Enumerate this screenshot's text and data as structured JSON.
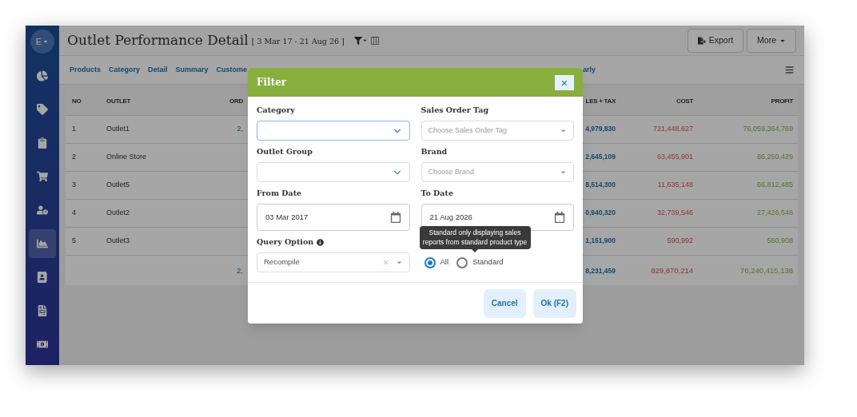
{
  "sidebar": {
    "avatar": "E",
    "items": [
      {
        "selected": false
      },
      {
        "selected": false
      },
      {
        "selected": false
      },
      {
        "selected": false
      },
      {
        "selected": false
      },
      {
        "selected": true
      },
      {
        "selected": false
      },
      {
        "selected": false
      },
      {
        "selected": false
      }
    ]
  },
  "header": {
    "title": "Outlet Performance Detail",
    "date_range": "[ 3 Mar 17 - 21 Aug 26 ]",
    "buttons": [
      {
        "label": "Export",
        "kind": "export"
      },
      {
        "label": "More",
        "kind": "more"
      }
    ]
  },
  "tabs": [
    {
      "label": "Products"
    },
    {
      "label": "Category"
    },
    {
      "label": "Detail"
    },
    {
      "label": "Summary"
    },
    {
      "label": "Custome"
    },
    {
      "label": "arly"
    }
  ],
  "table": {
    "columns": [
      "NO",
      "OUTLET",
      "ORD",
      "LES + TAX",
      "COST",
      "PROFIT"
    ],
    "rows": [
      [
        "1",
        "Outlet1",
        "2,",
        "4,979,830",
        "721,448,627",
        "76,059,364,769"
      ],
      [
        "2",
        "Online Store",
        null,
        "2,645,109",
        "63,455,901",
        "86,250,429"
      ],
      [
        "3",
        "Outlet5",
        null,
        "8,514,300",
        "11,635,148",
        "66,812,485"
      ],
      [
        "4",
        "Outlet2",
        null,
        "0,940,320",
        "32,739,546",
        "27,426,548"
      ],
      [
        "5",
        "Outlet3",
        null,
        "1,151,900",
        "590,992",
        "560,908"
      ]
    ],
    "total": {
      "column_3": "2,",
      "column_4": "8,231,459",
      "column_5": "829,870,214",
      "column_6": "76,240,415,138"
    }
  },
  "dialog": {
    "title": "Filter",
    "close": "×",
    "fields": [
      {
        "label": "Category",
        "kind": "select",
        "focused": true
      },
      {
        "label": "Sales Order Tag",
        "kind": "dropdown",
        "placeholder": "Choose Sales Order Tag"
      },
      {
        "label": "Outlet Group",
        "kind": "select",
        "focused": false
      },
      {
        "label": "Brand",
        "kind": "dropdown",
        "placeholder": "Choose Brand"
      },
      {
        "label": "From Date",
        "kind": "date",
        "value": "03 Mar 2017"
      },
      {
        "label": "To Date",
        "kind": "date",
        "value": "21 Aug 2026"
      },
      {
        "label": "Query Option",
        "kind": "clearable",
        "value": "Recompile",
        "info": true
      },
      {
        "kind": "radios",
        "options": [
          {
            "label": "All",
            "selected": true
          },
          {
            "label": "Standard",
            "selected": false
          }
        ]
      }
    ],
    "tooltip": "Standard only displaying sales reports from standard product type",
    "buttons": [
      {
        "label": "Cancel"
      },
      {
        "label": "Ok (F2)"
      }
    ]
  }
}
